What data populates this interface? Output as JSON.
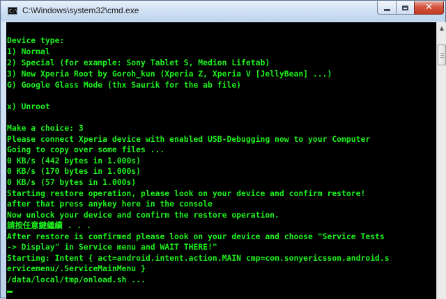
{
  "window": {
    "title": "C:\\Windows\\system32\\cmd.exe",
    "icon_name": "cmd-icon",
    "icon_text": "C:\\",
    "controls": {
      "minimize_icon": "minimize-icon",
      "maximize_icon": "maximize-icon",
      "close_glyph": "✕"
    }
  },
  "console": {
    "text_color": "#1df21d",
    "background": "#000000",
    "lines": [
      "Device type:",
      "1) Normal",
      "2) Special (for example: Sony Tablet S, Medion Lifetab)",
      "3) New Xperia Root by Goroh_kun (Xperia Z, Xperia V [JellyBean] ...)",
      "G) Google Glass Mode (thx Saurik for the ab file)",
      "",
      "x) Unroot",
      "",
      "Make a choice: 3",
      "Please connect Xperia device with enabled USB-Debugging now to your Computer",
      "Going to copy over some files ...",
      "0 KB/s (442 bytes in 1.000s)",
      "0 KB/s (170 bytes in 1.000s)",
      "0 KB/s (57 bytes in 1.000s)",
      "Starting restore operation, please look on your device and confirm restore!",
      "after that press anykey here in the console",
      "Now unlock your device and confirm the restore operation.",
      "請按任意鍵繼續 . . .",
      "After restore is confirmed please look on your device and choose \"Service Tests",
      "-> Display\" in Service menu and WAIT THERE!\"",
      "Starting: Intent { act=android.intent.action.MAIN cmp=com.sonyericsson.android.s",
      "ervicemenu/.ServiceMainMenu }",
      "/data/local/tmp/onload.sh ..."
    ]
  },
  "scrollbar": {
    "up_arrow": "▲"
  }
}
